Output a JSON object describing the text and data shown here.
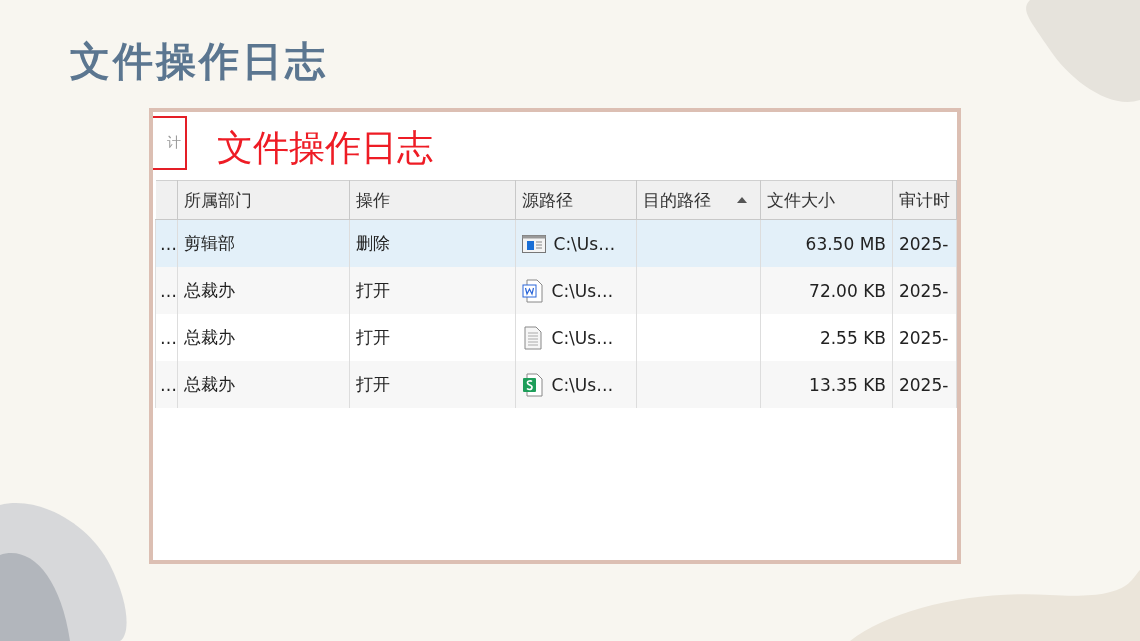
{
  "slide": {
    "title": "文件操作日志"
  },
  "screenshot": {
    "cut_label": "计",
    "heading": "文件操作日志",
    "table": {
      "columns": [
        {
          "sorted": false
        },
        {
          "label": "所属部门",
          "sorted": false
        },
        {
          "label": "操作",
          "sorted": false
        },
        {
          "label": "源路径",
          "sorted": false
        },
        {
          "label": "目的路径",
          "sorted": true
        },
        {
          "label": "文件大小",
          "sorted": false
        },
        {
          "label": "审计时",
          "sorted": false
        }
      ],
      "rows": [
        {
          "selected": true,
          "column_1": "…",
          "department": "剪辑部",
          "action": "删除",
          "kind": "app",
          "source": "C:\\Us…",
          "size": "63.50 MB",
          "audit_time": "2025-"
        },
        {
          "selected": false,
          "column_1": "…",
          "department": "总裁办",
          "action": "打开",
          "kind": "word",
          "source": "C:\\Us…",
          "size": "72.00 KB",
          "audit_time": "2025-"
        },
        {
          "selected": false,
          "column_1": "…",
          "department": "总裁办",
          "action": "打开",
          "kind": "text",
          "source": "C:\\Us…",
          "size": "2.55 KB",
          "audit_time": "2025-"
        },
        {
          "selected": false,
          "column_1": "…",
          "department": "总裁办",
          "action": "打开",
          "kind": "sheet",
          "source": "C:\\Us…",
          "size": "13.35 KB",
          "audit_time": "2025-"
        }
      ]
    }
  }
}
